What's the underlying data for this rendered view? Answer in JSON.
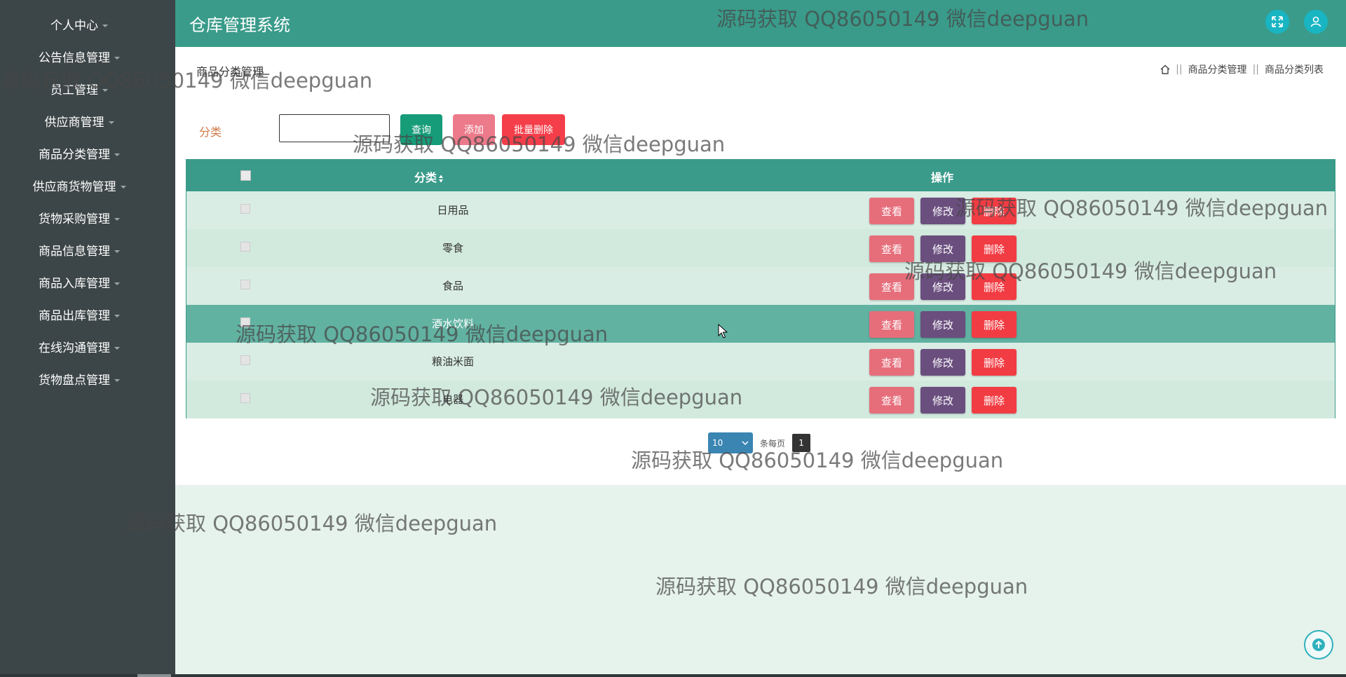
{
  "app": {
    "title": "仓库管理系统"
  },
  "sidebar": {
    "items": [
      {
        "label": "个人中心"
      },
      {
        "label": "公告信息管理"
      },
      {
        "label": "员工管理"
      },
      {
        "label": "供应商管理"
      },
      {
        "label": "商品分类管理"
      },
      {
        "label": "供应商货物管理"
      },
      {
        "label": "货物采购管理"
      },
      {
        "label": "商品信息管理"
      },
      {
        "label": "商品入库管理"
      },
      {
        "label": "商品出库管理"
      },
      {
        "label": "在线沟通管理"
      },
      {
        "label": "货物盘点管理"
      }
    ]
  },
  "page": {
    "heading": "商品分类管理",
    "breadcrumb": [
      "商品分类管理",
      "商品分类列表"
    ]
  },
  "filter": {
    "label": "分类",
    "value": "",
    "query_label": "查询",
    "add_label": "添加",
    "batch_delete_label": "批量删除"
  },
  "table": {
    "headers": {
      "category": "分类",
      "sort_icon": "sort-icon",
      "actions": "操作"
    },
    "rows": [
      {
        "category": "日用品"
      },
      {
        "category": "零食"
      },
      {
        "category": "食品"
      },
      {
        "category": "酒水饮料"
      },
      {
        "category": "粮油米面"
      },
      {
        "category": "电器"
      }
    ],
    "actions": {
      "view": "查看",
      "edit": "修改",
      "delete": "删除"
    }
  },
  "pagination": {
    "page_size": "10",
    "per_page_label": "条每页",
    "current_page": "1"
  },
  "watermark": "源码获取 QQ86050149 微信deepguan",
  "colors": {
    "header": "#3a9b8a",
    "sidebar": "#3c4547",
    "view": "#e66e7b",
    "edit": "#6a4e7e",
    "delete": "#f23c43",
    "query": "#169c78"
  }
}
